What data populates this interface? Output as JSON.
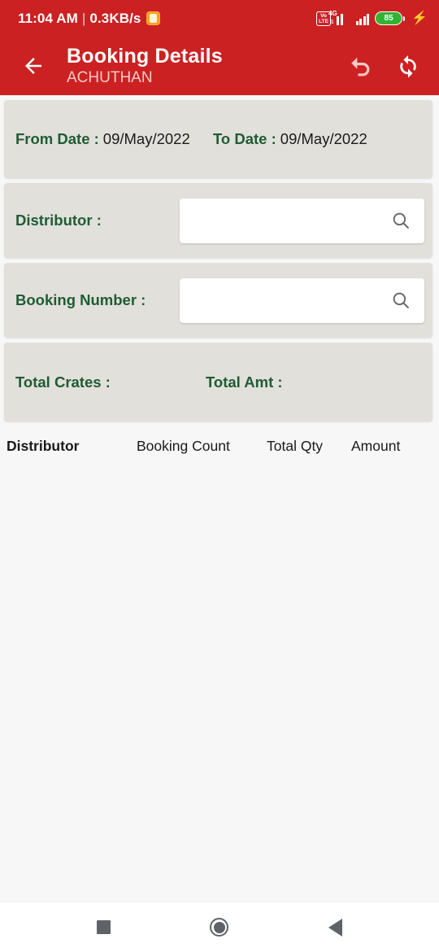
{
  "statusbar": {
    "time": "11:04 AM",
    "separator": "|",
    "network_speed": "0.3KB/s",
    "volte_top": "Vo",
    "volte_bottom": "LTE",
    "network_type": "4G",
    "battery_percent": "85",
    "charging_icon": "⚡",
    "data_badge_icon": "data-usage-icon"
  },
  "appbar": {
    "back_icon": "arrow-left-icon",
    "title": "Booking Details",
    "subtitle": "ACHUTHAN",
    "undo_icon": "undo-icon",
    "refresh_icon": "refresh-icon",
    "background_color": "#cc2122"
  },
  "dates": {
    "from_label": "From Date :",
    "from_value": "09/May/2022",
    "to_label": "To Date :",
    "to_value": "09/May/2022"
  },
  "distributor": {
    "label": "Distributor :",
    "value": "",
    "placeholder": "",
    "search_icon": "search-icon"
  },
  "booking_number": {
    "label": "Booking Number :",
    "value": "",
    "placeholder": "",
    "search_icon": "search-icon"
  },
  "totals": {
    "crates_label": "Total Crates :",
    "crates_value": "",
    "amount_label": "Total Amt :",
    "amount_value": ""
  },
  "table": {
    "columns": [
      "Distributor",
      "Booking Count",
      "Total Qty",
      "Amount"
    ],
    "rows": []
  },
  "navbar": {
    "recents_icon": "square-recents-icon",
    "home_icon": "circle-home-icon",
    "back_icon": "triangle-back-icon"
  },
  "colors": {
    "brand_red": "#cc2122",
    "label_green": "#1f5c35",
    "card_gray": "#e2e0db",
    "page_bg": "#f7f7f8",
    "battery_green": "#34b233"
  }
}
